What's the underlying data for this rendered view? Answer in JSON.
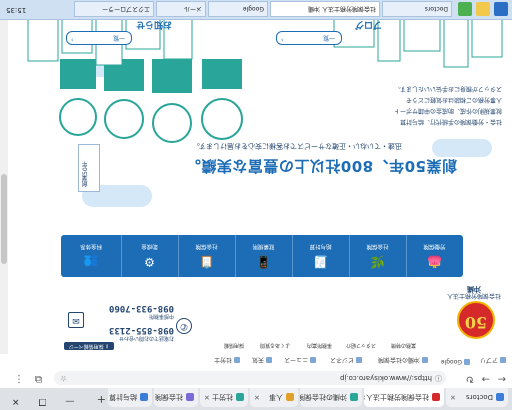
{
  "browser": {
    "tabs": [
      {
        "label": "Doctors"
      },
      {
        "label": "社会保険労務士法人"
      },
      {
        "label": "沖縄の社会保険…"
      },
      {
        "label": "人事"
      },
      {
        "label": "社労士"
      },
      {
        "label": "社会保険"
      },
      {
        "label": "給与計算"
      }
    ],
    "new_tab": "+",
    "url": "https://www.okisyaro.co.jp",
    "window_controls": "— ❐ ✕"
  },
  "bookmarks": [
    "アプリ",
    "Google",
    "沖縄の社会保険",
    "ビジネス",
    "ニュース",
    "天気",
    "社労士"
  ],
  "page": {
    "utility": {
      "recruit": "採用情報ページ",
      "links": [
        "業務の特徴",
        "スタッフ紹介",
        "事務所案内",
        "よくある質問",
        "採用情報"
      ]
    },
    "logo": {
      "badge": "50",
      "title": "社会保険労務士法人",
      "name": "沖縄"
    },
    "contact": {
      "phone_label": "お電話でのお問い合わせ",
      "phone": "098-855-2133",
      "fax_label": "中部事務所",
      "fax": "098-933-7060"
    },
    "nav": [
      {
        "icon": "👛",
        "label": "労働保険"
      },
      {
        "icon": "🌿",
        "label": "社会保険"
      },
      {
        "icon": "🧾",
        "label": "給与計算"
      },
      {
        "icon": "📱",
        "label": "就業規則"
      },
      {
        "icon": "📋",
        "label": "社会保険"
      },
      {
        "icon": "⚙",
        "label": "助成金"
      },
      {
        "icon": "👥",
        "label": "料金体系"
      }
    ],
    "hero": {
      "title": "創業50年、800社以上の豊富な実績。",
      "subtitle": "迅速・ていねい・正確なサービスでお客様に安心をお届けします。",
      "list": [
        "社会・労働保険の手続代行、給与計算",
        "就業規則の作成、助成金の申請サポート",
        "人事労務のご相談はお気軽にどうぞ",
        "スタッフが親身にお手伝いいたします。"
      ],
      "ribbon": "創業50年",
      "buttons": [
        "一覧",
        "一覧"
      ],
      "sections": [
        "お知らせ",
        "ブログ"
      ]
    }
  },
  "taskbar": {
    "apps": [
      {
        "label": "Doctors"
      },
      {
        "label": "社会保険労務士法人 沖縄"
      },
      {
        "label": "Google"
      },
      {
        "label": "メール"
      },
      {
        "label": "エクスプローラー"
      }
    ],
    "clock": "15:35"
  },
  "colors": {
    "brand": "#1d6db6",
    "navy": "#23456f",
    "teal": "#2aa59a",
    "red": "#d62a2a"
  }
}
